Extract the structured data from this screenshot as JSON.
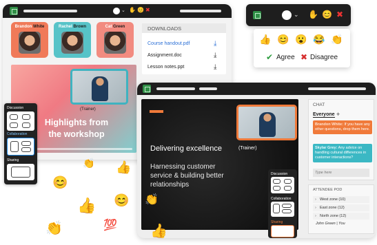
{
  "window_a": {
    "participants": [
      {
        "first": "Brandon",
        "last": "White",
        "color": "#f07a59"
      },
      {
        "first": "Rachel",
        "last": "Brown",
        "color": "#57c3c8"
      },
      {
        "first": "Cat",
        "last": "Green",
        "color": "#f28b80"
      }
    ],
    "downloads": {
      "title": "DOWNLOADS",
      "files": [
        {
          "name": "Course handout.pdf",
          "highlight": true
        },
        {
          "name": "Assignment.doc",
          "highlight": false
        },
        {
          "name": "Lesson notes.ppt",
          "highlight": false
        }
      ]
    },
    "slide": {
      "headline": "Highlights from the workshop",
      "trainer_label": "(Trainer)"
    }
  },
  "window_b": {
    "slide": {
      "title": "Delivering excellence",
      "subtitle": "Harnessing customer service & building better relationships",
      "trainer_label": "(Trainer)"
    },
    "groups": {
      "discussion": "Discussion",
      "collaboration": "Collaboration",
      "sharing": "Sharing"
    },
    "chat": {
      "title": "CHAT",
      "tab": "Everyone",
      "add": "+",
      "messages": [
        {
          "author": "Brandon White:",
          "text": "If you have any other questions, drop them here."
        },
        {
          "author": "Skylar Grey:",
          "text": "Any advice on handling cultural differences in customer interactions?"
        }
      ],
      "placeholder": "Type here"
    },
    "pod": {
      "title": "ATTENDEE POD",
      "zones": [
        {
          "label": "West zone (10)"
        },
        {
          "label": "East zone (12)"
        },
        {
          "label": "North zone (12)"
        }
      ],
      "member": "John Green",
      "member_tag": "You"
    }
  },
  "side_panel": {
    "discussion": "Discussion",
    "collaboration": "Collaboration",
    "sharing": "Sharing"
  },
  "reactions_bar": {
    "emojis": [
      "✋",
      "😊",
      "✖"
    ]
  },
  "reactions_panel": {
    "emojis": [
      "👍",
      "😊",
      "😮",
      "😂",
      "👏"
    ],
    "agree": "Agree",
    "disagree": "Disagree"
  },
  "floating_emojis": [
    "👏",
    "👍",
    "😊",
    "👍",
    "😊",
    "👏",
    "💯",
    "👏",
    "👍"
  ],
  "colors": {
    "accent_orange": "#f07a3a",
    "accent_teal": "#3bb8c4",
    "dark_bar": "#1e1e1e",
    "agree_green": "#2c9c3e",
    "disagree_red": "#d62f2f"
  }
}
